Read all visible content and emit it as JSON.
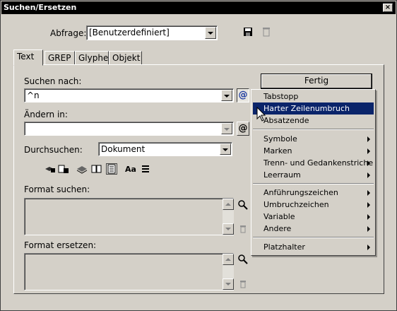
{
  "window": {
    "title": "Suchen/Ersetzen",
    "close": "×"
  },
  "query": {
    "label": "Abfrage:",
    "value": "[Benutzerdefiniert]"
  },
  "tabs": [
    {
      "label": "Text"
    },
    {
      "label": "GREP"
    },
    {
      "label": "Glyphe"
    },
    {
      "label": "Objekt"
    }
  ],
  "find": {
    "label": "Suchen nach:",
    "value": "^n"
  },
  "change": {
    "label": "Ändern in:",
    "value": ""
  },
  "search_in": {
    "label": "Durchsuchen:",
    "value": "Dokument"
  },
  "options_icons": [
    "locked-layers-icon",
    "locked-stories-icon",
    "hidden-layers-icon",
    "master-pages-icon",
    "footnotes-icon",
    "case-sensitive-icon",
    "whole-word-icon"
  ],
  "case_icon_text": "Aa",
  "format_find": {
    "label": "Format suchen:"
  },
  "format_change": {
    "label": "Format ersetzen:"
  },
  "done_button": "Fertig",
  "special_chars_menu": {
    "items": [
      {
        "label": "Tabstopp",
        "submenu": false
      },
      {
        "label": "Harter Zeilenumbruch",
        "submenu": false,
        "highlighted": true
      },
      {
        "label": "Absatzende",
        "submenu": false
      },
      {
        "label": "Symbole",
        "submenu": true
      },
      {
        "label": "Marken",
        "submenu": true
      },
      {
        "label": "Trenn- und Gedankenstriche",
        "submenu": true
      },
      {
        "label": "Leerraum",
        "submenu": true
      },
      {
        "label": "Anführungszeichen",
        "submenu": true
      },
      {
        "label": "Umbruchzeichen",
        "submenu": true
      },
      {
        "label": "Variable",
        "submenu": true
      },
      {
        "label": "Andere",
        "submenu": true
      },
      {
        "label": "Platzhalter",
        "submenu": true
      }
    ]
  },
  "colors": {
    "highlight": "#0a246a",
    "dialog_bg": "#d4d0c8",
    "titlebar": "#000000"
  }
}
